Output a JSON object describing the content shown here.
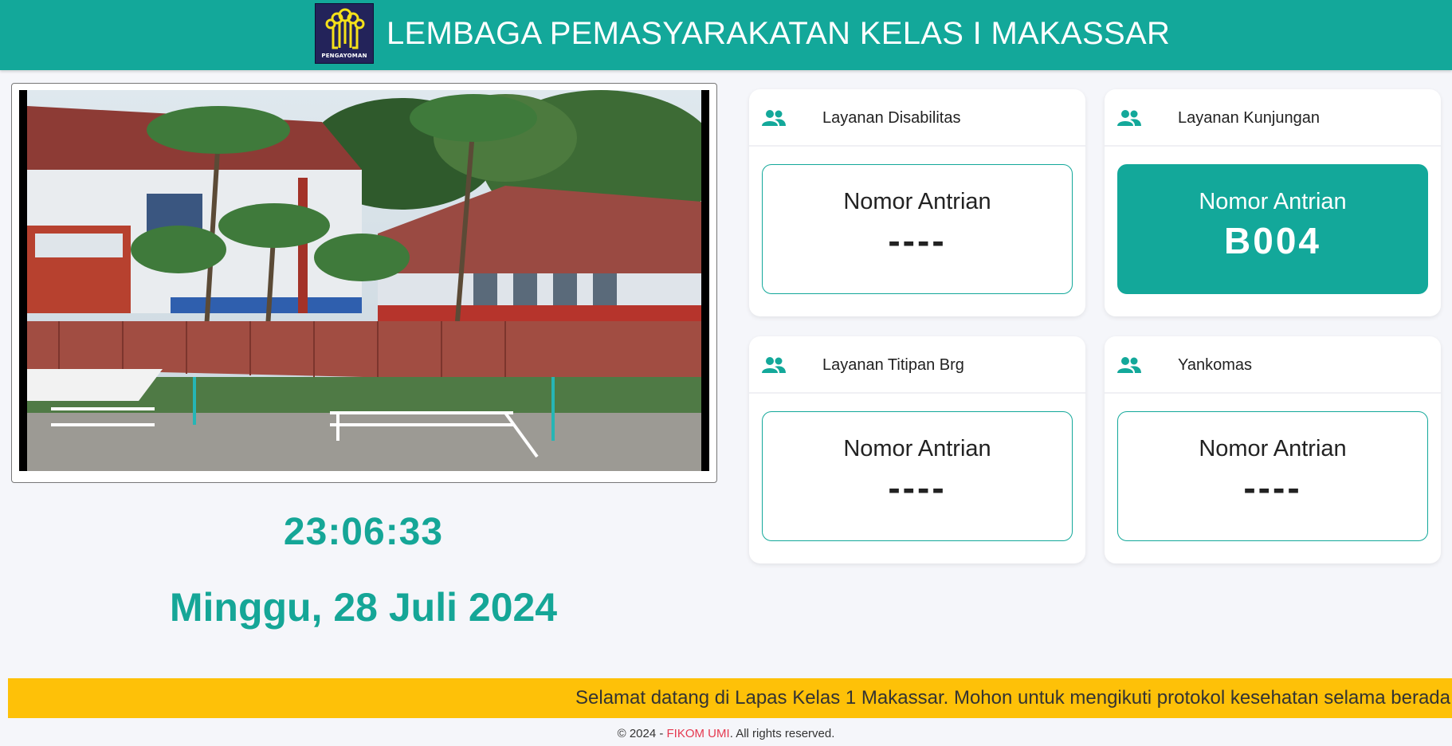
{
  "header": {
    "title": "LEMBAGA PEMASYARAKATAN KELAS I MAKASSAR",
    "logo_text": "PENGAYOMAN",
    "logo_icon": "pengayoman-emblem-icon"
  },
  "clock": {
    "time": "23:06:33",
    "date": "Minggu, 28 Juli 2024"
  },
  "services": [
    {
      "title": "Layanan Disabilitas",
      "icon": "users-icon",
      "label": "Nomor Antrian",
      "number": "----",
      "active": false
    },
    {
      "title": "Layanan Kunjungan",
      "icon": "users-icon",
      "label": "Nomor Antrian",
      "number": "B004",
      "active": true
    },
    {
      "title": "Layanan Titipan Brg",
      "icon": "users-icon",
      "label": "Nomor Antrian",
      "number": "----",
      "active": false
    },
    {
      "title": "Yankomas",
      "icon": "users-icon",
      "label": "Nomor Antrian",
      "number": "----",
      "active": false
    }
  ],
  "ticker": {
    "text": "Selamat datang di Lapas Kelas 1 Makassar. Mohon untuk mengikuti protokol kesehatan selama berada"
  },
  "footer": {
    "prefix": "© 2024 - ",
    "brand": "FIKOM UMI",
    "suffix": ". All rights reserved."
  },
  "colors": {
    "primary": "#13a89a",
    "ticker_bg": "#fec108",
    "brand_link": "#e53950",
    "logo_bg": "#23235a"
  }
}
